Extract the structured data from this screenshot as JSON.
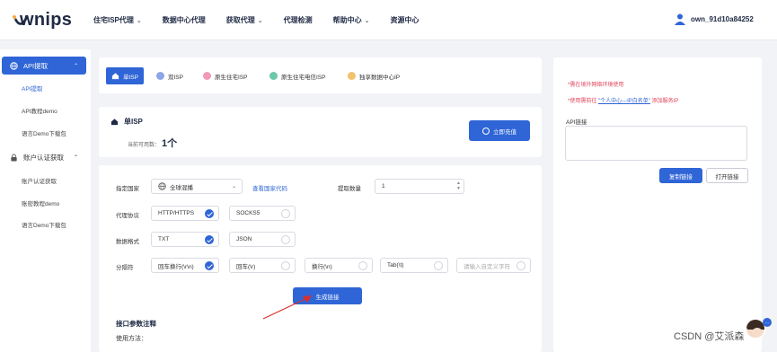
{
  "header": {
    "logo_text": "wnips",
    "nav": [
      {
        "label": "住宅ISP代理",
        "has_dropdown": true
      },
      {
        "label": "数据中心代理",
        "has_dropdown": false
      },
      {
        "label": "获取代理",
        "has_dropdown": true
      },
      {
        "label": "代理检测",
        "has_dropdown": false
      },
      {
        "label": "帮助中心",
        "has_dropdown": true
      },
      {
        "label": "资源中心",
        "has_dropdown": false
      }
    ],
    "username": "own_91d10a84252"
  },
  "sidebar": {
    "groups": [
      {
        "label": "API提取",
        "active": true,
        "items": [
          "API提取",
          "API教程demo",
          "语言Demo下载包"
        ]
      },
      {
        "label": "账户认证获取",
        "active": false,
        "items": [
          "账户认证获取",
          "账密教程demo",
          "语言Demo下载包"
        ]
      }
    ]
  },
  "tabs": [
    {
      "label": "单ISP",
      "active": true
    },
    {
      "label": "双ISP",
      "active": false
    },
    {
      "label": "原生住宅ISP",
      "active": false
    },
    {
      "label": "原生住宅电信ISP",
      "active": false
    },
    {
      "label": "独享数据中心IP",
      "active": false
    }
  ],
  "isp_card": {
    "title": "单ISP",
    "available_label": "当前可用数：",
    "available_value": "1个",
    "recharge_label": "立即充值"
  },
  "form": {
    "country": {
      "label": "指定国家",
      "value": "全球混播",
      "link": "查看国家代码"
    },
    "quantity": {
      "label": "提取数量",
      "value": "1"
    },
    "protocol": {
      "label": "代理协议",
      "options": [
        {
          "label": "HTTP/HTTPS",
          "checked": true
        },
        {
          "label": "SOCKS5",
          "checked": false
        }
      ]
    },
    "format": {
      "label": "数据格式",
      "options": [
        {
          "label": "TXT",
          "checked": true
        },
        {
          "label": "JSON",
          "checked": false
        }
      ]
    },
    "separator": {
      "label": "分隔符",
      "options": [
        {
          "label": "回车换行(\\r\\n)",
          "checked": true
        },
        {
          "label": "回车(\\r)",
          "checked": false
        },
        {
          "label": "换行(\\n)",
          "checked": false
        },
        {
          "label": "Tab(\\t)",
          "checked": false
        }
      ],
      "custom_placeholder": "请输入自定义字符"
    },
    "generate_label": "生成链接",
    "section_title": "接口参数注释",
    "section_sub": "使用方法："
  },
  "right_panel": {
    "note1": "*需在境外网络环境使用",
    "note2_prefix": "*使用需前往",
    "note2_link": "\"个人中心---IP白名单\"",
    "note2_suffix": "添加服务IP",
    "api_label": "API链接",
    "copy_label": "复制链接",
    "open_label": "打开链接"
  },
  "watermark": "CSDN @艾派森",
  "colors": {
    "primary": "#2f65d6",
    "note_red": "#e0425a",
    "heading": "#1f2a44"
  }
}
